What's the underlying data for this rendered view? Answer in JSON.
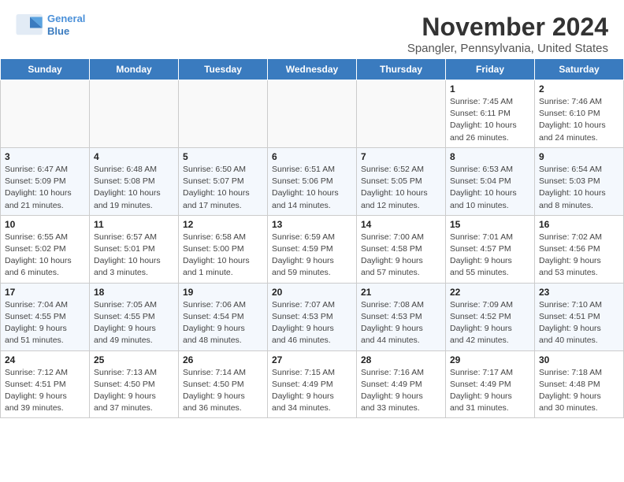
{
  "header": {
    "logo_line1": "General",
    "logo_line2": "Blue",
    "month_title": "November 2024",
    "location": "Spangler, Pennsylvania, United States"
  },
  "weekdays": [
    "Sunday",
    "Monday",
    "Tuesday",
    "Wednesday",
    "Thursday",
    "Friday",
    "Saturday"
  ],
  "weeks": [
    [
      {
        "day": "",
        "detail": ""
      },
      {
        "day": "",
        "detail": ""
      },
      {
        "day": "",
        "detail": ""
      },
      {
        "day": "",
        "detail": ""
      },
      {
        "day": "",
        "detail": ""
      },
      {
        "day": "1",
        "detail": "Sunrise: 7:45 AM\nSunset: 6:11 PM\nDaylight: 10 hours\nand 26 minutes."
      },
      {
        "day": "2",
        "detail": "Sunrise: 7:46 AM\nSunset: 6:10 PM\nDaylight: 10 hours\nand 24 minutes."
      }
    ],
    [
      {
        "day": "3",
        "detail": "Sunrise: 6:47 AM\nSunset: 5:09 PM\nDaylight: 10 hours\nand 21 minutes."
      },
      {
        "day": "4",
        "detail": "Sunrise: 6:48 AM\nSunset: 5:08 PM\nDaylight: 10 hours\nand 19 minutes."
      },
      {
        "day": "5",
        "detail": "Sunrise: 6:50 AM\nSunset: 5:07 PM\nDaylight: 10 hours\nand 17 minutes."
      },
      {
        "day": "6",
        "detail": "Sunrise: 6:51 AM\nSunset: 5:06 PM\nDaylight: 10 hours\nand 14 minutes."
      },
      {
        "day": "7",
        "detail": "Sunrise: 6:52 AM\nSunset: 5:05 PM\nDaylight: 10 hours\nand 12 minutes."
      },
      {
        "day": "8",
        "detail": "Sunrise: 6:53 AM\nSunset: 5:04 PM\nDaylight: 10 hours\nand 10 minutes."
      },
      {
        "day": "9",
        "detail": "Sunrise: 6:54 AM\nSunset: 5:03 PM\nDaylight: 10 hours\nand 8 minutes."
      }
    ],
    [
      {
        "day": "10",
        "detail": "Sunrise: 6:55 AM\nSunset: 5:02 PM\nDaylight: 10 hours\nand 6 minutes."
      },
      {
        "day": "11",
        "detail": "Sunrise: 6:57 AM\nSunset: 5:01 PM\nDaylight: 10 hours\nand 3 minutes."
      },
      {
        "day": "12",
        "detail": "Sunrise: 6:58 AM\nSunset: 5:00 PM\nDaylight: 10 hours\nand 1 minute."
      },
      {
        "day": "13",
        "detail": "Sunrise: 6:59 AM\nSunset: 4:59 PM\nDaylight: 9 hours\nand 59 minutes."
      },
      {
        "day": "14",
        "detail": "Sunrise: 7:00 AM\nSunset: 4:58 PM\nDaylight: 9 hours\nand 57 minutes."
      },
      {
        "day": "15",
        "detail": "Sunrise: 7:01 AM\nSunset: 4:57 PM\nDaylight: 9 hours\nand 55 minutes."
      },
      {
        "day": "16",
        "detail": "Sunrise: 7:02 AM\nSunset: 4:56 PM\nDaylight: 9 hours\nand 53 minutes."
      }
    ],
    [
      {
        "day": "17",
        "detail": "Sunrise: 7:04 AM\nSunset: 4:55 PM\nDaylight: 9 hours\nand 51 minutes."
      },
      {
        "day": "18",
        "detail": "Sunrise: 7:05 AM\nSunset: 4:55 PM\nDaylight: 9 hours\nand 49 minutes."
      },
      {
        "day": "19",
        "detail": "Sunrise: 7:06 AM\nSunset: 4:54 PM\nDaylight: 9 hours\nand 48 minutes."
      },
      {
        "day": "20",
        "detail": "Sunrise: 7:07 AM\nSunset: 4:53 PM\nDaylight: 9 hours\nand 46 minutes."
      },
      {
        "day": "21",
        "detail": "Sunrise: 7:08 AM\nSunset: 4:53 PM\nDaylight: 9 hours\nand 44 minutes."
      },
      {
        "day": "22",
        "detail": "Sunrise: 7:09 AM\nSunset: 4:52 PM\nDaylight: 9 hours\nand 42 minutes."
      },
      {
        "day": "23",
        "detail": "Sunrise: 7:10 AM\nSunset: 4:51 PM\nDaylight: 9 hours\nand 40 minutes."
      }
    ],
    [
      {
        "day": "24",
        "detail": "Sunrise: 7:12 AM\nSunset: 4:51 PM\nDaylight: 9 hours\nand 39 minutes."
      },
      {
        "day": "25",
        "detail": "Sunrise: 7:13 AM\nSunset: 4:50 PM\nDaylight: 9 hours\nand 37 minutes."
      },
      {
        "day": "26",
        "detail": "Sunrise: 7:14 AM\nSunset: 4:50 PM\nDaylight: 9 hours\nand 36 minutes."
      },
      {
        "day": "27",
        "detail": "Sunrise: 7:15 AM\nSunset: 4:49 PM\nDaylight: 9 hours\nand 34 minutes."
      },
      {
        "day": "28",
        "detail": "Sunrise: 7:16 AM\nSunset: 4:49 PM\nDaylight: 9 hours\nand 33 minutes."
      },
      {
        "day": "29",
        "detail": "Sunrise: 7:17 AM\nSunset: 4:49 PM\nDaylight: 9 hours\nand 31 minutes."
      },
      {
        "day": "30",
        "detail": "Sunrise: 7:18 AM\nSunset: 4:48 PM\nDaylight: 9 hours\nand 30 minutes."
      }
    ]
  ]
}
